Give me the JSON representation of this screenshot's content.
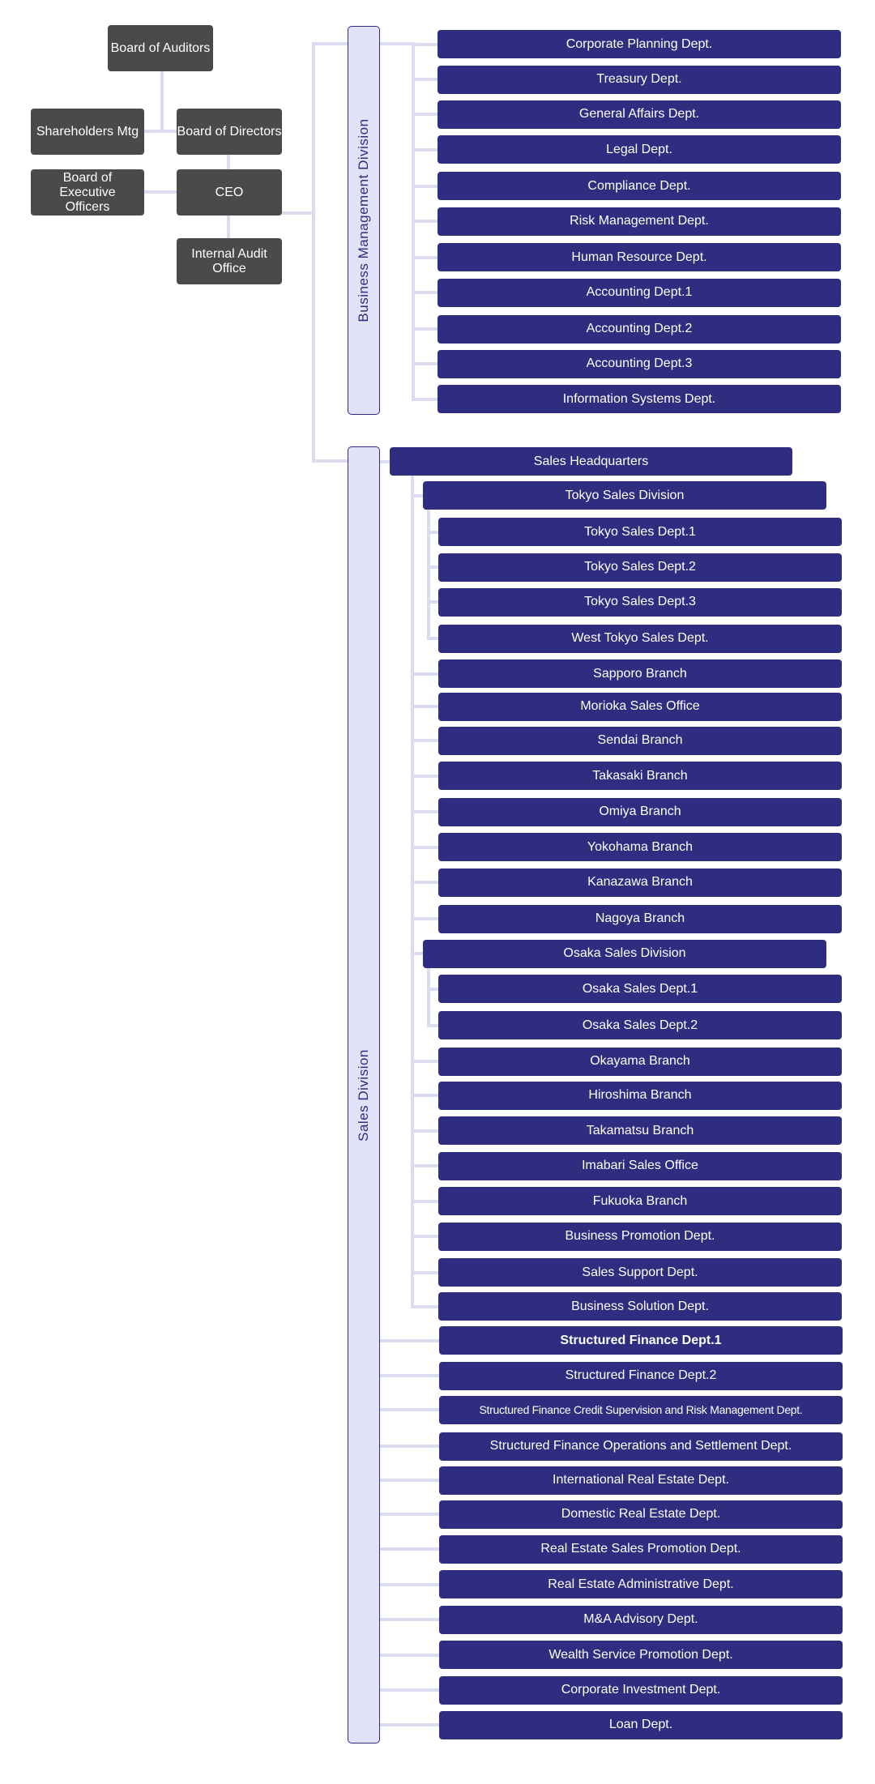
{
  "executive": {
    "board_of_auditors": "Board of Auditors",
    "shareholders": "Shareholders Mtg",
    "board_of_directors": "Board of Directors",
    "board_of_executive_officers": "Board of Executive Officers",
    "ceo": "CEO",
    "internal_audit": "Internal Audit Office"
  },
  "business_management": {
    "label": "Business Management Division",
    "depts": [
      "Corporate Planning Dept.",
      "Treasury Dept.",
      "General Affairs Dept.",
      "Legal Dept.",
      "Compliance Dept.",
      "Risk Management Dept.",
      "Human Resource Dept.",
      "Accounting Dept.1",
      "Accounting Dept.2",
      "Accounting Dept.3",
      "Information Systems Dept."
    ]
  },
  "sales": {
    "label": "Sales Division",
    "items": [
      {
        "label": "Sales Headquarters",
        "parent": "Sales Division"
      },
      {
        "label": "Tokyo Sales Division",
        "parent": "Sales Headquarters"
      },
      {
        "label": "Tokyo Sales Dept.1",
        "parent": "Tokyo Sales Division"
      },
      {
        "label": "Tokyo Sales Dept.2",
        "parent": "Tokyo Sales Division"
      },
      {
        "label": "Tokyo Sales Dept.3",
        "parent": "Tokyo Sales Division"
      },
      {
        "label": "West Tokyo Sales Dept.",
        "parent": "Tokyo Sales Division"
      },
      {
        "label": "Sapporo Branch",
        "parent": "Sales Headquarters"
      },
      {
        "label": "Morioka Sales Office",
        "parent": "Sales Headquarters"
      },
      {
        "label": "Sendai Branch",
        "parent": "Sales Headquarters"
      },
      {
        "label": "Takasaki Branch",
        "parent": "Sales Headquarters"
      },
      {
        "label": "Omiya Branch",
        "parent": "Sales Headquarters"
      },
      {
        "label": "Yokohama Branch",
        "parent": "Sales Headquarters"
      },
      {
        "label": "Kanazawa Branch",
        "parent": "Sales Headquarters"
      },
      {
        "label": "Nagoya Branch",
        "parent": "Sales Headquarters"
      },
      {
        "label": "Osaka Sales Division",
        "parent": "Sales Headquarters"
      },
      {
        "label": "Osaka Sales Dept.1",
        "parent": "Osaka Sales Division"
      },
      {
        "label": "Osaka Sales Dept.2",
        "parent": "Osaka Sales Division"
      },
      {
        "label": "Okayama Branch",
        "parent": "Sales Headquarters"
      },
      {
        "label": "Hiroshima Branch",
        "parent": "Sales Headquarters"
      },
      {
        "label": "Takamatsu Branch",
        "parent": "Sales Headquarters"
      },
      {
        "label": "Imabari Sales Office",
        "parent": "Sales Headquarters"
      },
      {
        "label": "Fukuoka Branch",
        "parent": "Sales Headquarters"
      },
      {
        "label": "Business Promotion Dept.",
        "parent": "Sales Headquarters"
      },
      {
        "label": "Sales Support Dept.",
        "parent": "Sales Headquarters"
      },
      {
        "label": "Business Solution Dept.",
        "parent": "Sales Headquarters"
      },
      {
        "label": "Structured Finance Dept.1",
        "parent": "Sales Division"
      },
      {
        "label": "Structured Finance Dept.2",
        "parent": "Sales Division"
      },
      {
        "label": "Structured Finance Credit Supervision and Risk Management Dept.",
        "parent": "Sales Division"
      },
      {
        "label": "Structured Finance Operations and Settlement Dept.",
        "parent": "Sales Division"
      },
      {
        "label": "International Real Estate Dept.",
        "parent": "Sales Division"
      },
      {
        "label": "Domestic Real Estate Dept.",
        "parent": "Sales Division"
      },
      {
        "label": "Real Estate Sales Promotion Dept.",
        "parent": "Sales Division"
      },
      {
        "label": "Real Estate Administrative Dept.",
        "parent": "Sales Division"
      },
      {
        "label": "M&A Advisory Dept.",
        "parent": "Sales Division"
      },
      {
        "label": "Wealth Service Promotion Dept.",
        "parent": "Sales Division"
      },
      {
        "label": "Corporate Investment Dept.",
        "parent": "Sales Division"
      },
      {
        "label": "Loan Dept.",
        "parent": "Sales Division"
      }
    ]
  },
  "colors": {
    "unit_box": "#2e2d80",
    "executive_box": "#4a4a4a",
    "division_fill": "#e1e1f7",
    "connector": "#dcdcf0"
  }
}
